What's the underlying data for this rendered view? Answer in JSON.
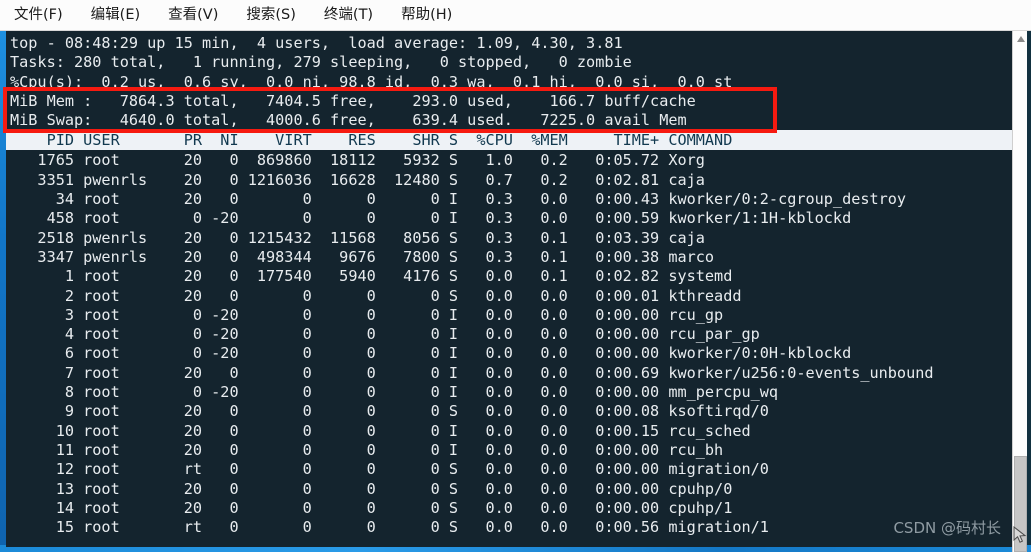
{
  "menubar": {
    "items": [
      {
        "label": "文件(F)"
      },
      {
        "label": "编辑(E)"
      },
      {
        "label": "查看(V)"
      },
      {
        "label": "搜索(S)"
      },
      {
        "label": "终端(T)"
      },
      {
        "label": "帮助(H)"
      }
    ]
  },
  "terminal": {
    "colors": {
      "background": "#14242e",
      "foreground": "#e8ecef",
      "header_background": "#eef2f6",
      "header_foreground": "#12394f",
      "annotation_red": "#f61a10",
      "window_border_blue": "#1b8ad8"
    },
    "summary": {
      "line1": "top - 08:48:29 up 15 min,  4 users,  load average: 1.09, 4.30, 3.81",
      "line2": "Tasks: 280 total,   1 running, 279 sleeping,   0 stopped,   0 zombie",
      "line3": "%Cpu(s):  0.2 us,  0.6 sy,  0.0 ni, 98.8 id,  0.3 wa,  0.1 hi,  0.0 si,  0.0 st",
      "line4": "MiB Mem :   7864.3 total,   7404.5 free,    293.0 used,    166.7 buff/cache",
      "line5": "MiB Swap:   4640.0 total,   4000.6 free,    639.4 used.   7225.0 avail Mem"
    },
    "summary_values": {
      "time": "08:48:29",
      "uptime": "15 min",
      "users": "4",
      "load_average": [
        "1.09",
        "4.30",
        "3.81"
      ],
      "tasks_total": "280",
      "tasks_running": "1",
      "tasks_sleeping": "279",
      "tasks_stopped": "0",
      "tasks_zombie": "0",
      "cpu_us": "0.2",
      "cpu_sy": "0.6",
      "cpu_ni": "0.0",
      "cpu_id": "98.8",
      "cpu_wa": "0.3",
      "cpu_hi": "0.1",
      "cpu_si": "0.0",
      "cpu_st": "0.0",
      "mem_unit": "MiB",
      "mem_total": "7864.3",
      "mem_free": "7404.5",
      "mem_used": "293.0",
      "mem_buff_cache": "166.7",
      "swap_total": "4640.0",
      "swap_free": "4000.6",
      "swap_used": "639.4",
      "swap_avail": "7225.0"
    },
    "column_header": "    PID USER       PR  NI    VIRT    RES    SHR S  %CPU  %MEM     TIME+ COMMAND",
    "columns": [
      "PID",
      "USER",
      "PR",
      "NI",
      "VIRT",
      "RES",
      "SHR",
      "S",
      "%CPU",
      "%MEM",
      "TIME+",
      "COMMAND"
    ],
    "rows": [
      "   1765 root       20   0  869860  18112   5932 S   1.0   0.2   0:05.72 Xorg",
      "   3351 pwenrls    20   0 1216036  16628  12480 S   0.7   0.2   0:02.81 caja",
      "     34 root       20   0       0      0      0 I   0.3   0.0   0:00.43 kworker/0:2-cgroup_destroy",
      "    458 root        0 -20       0      0      0 I   0.3   0.0   0:00.59 kworker/1:1H-kblockd",
      "   2518 pwenrls    20   0 1215432  11568   8056 S   0.3   0.1   0:03.39 caja",
      "   3347 pwenrls    20   0  498344   9676   7800 S   0.3   0.1   0:00.38 marco",
      "      1 root       20   0  177540   5940   4176 S   0.0   0.1   0:02.82 systemd",
      "      2 root       20   0       0      0      0 S   0.0   0.0   0:00.01 kthreadd",
      "      3 root        0 -20       0      0      0 I   0.0   0.0   0:00.00 rcu_gp",
      "      4 root        0 -20       0      0      0 I   0.0   0.0   0:00.00 rcu_par_gp",
      "      6 root        0 -20       0      0      0 I   0.0   0.0   0:00.00 kworker/0:0H-kblockd",
      "      7 root       20   0       0      0      0 I   0.0   0.0   0:00.69 kworker/u256:0-events_unbound",
      "      8 root        0 -20       0      0      0 I   0.0   0.0   0:00.00 mm_percpu_wq",
      "      9 root       20   0       0      0      0 S   0.0   0.0   0:00.08 ksoftirqd/0",
      "     10 root       20   0       0      0      0 I   0.0   0.0   0:00.15 rcu_sched",
      "     11 root       20   0       0      0      0 I   0.0   0.0   0:00.00 rcu_bh",
      "     12 root       rt   0       0      0      0 S   0.0   0.0   0:00.00 migration/0",
      "     13 root       20   0       0      0      0 S   0.0   0.0   0:00.00 cpuhp/0",
      "     14 root       20   0       0      0      0 S   0.0   0.0   0:00.00 cpuhp/1",
      "     15 root       rt   0       0      0      0 S   0.0   0.0   0:00.56 migration/1"
    ],
    "rows_data": [
      {
        "pid": "1765",
        "user": "root",
        "pr": "20",
        "ni": "0",
        "virt": "869860",
        "res": "18112",
        "shr": "5932",
        "s": "S",
        "cpu": "1.0",
        "mem": "0.2",
        "time": "0:05.72",
        "command": "Xorg"
      },
      {
        "pid": "3351",
        "user": "pwenrls",
        "pr": "20",
        "ni": "0",
        "virt": "1216036",
        "res": "16628",
        "shr": "12480",
        "s": "S",
        "cpu": "0.7",
        "mem": "0.2",
        "time": "0:02.81",
        "command": "caja"
      },
      {
        "pid": "34",
        "user": "root",
        "pr": "20",
        "ni": "0",
        "virt": "0",
        "res": "0",
        "shr": "0",
        "s": "I",
        "cpu": "0.3",
        "mem": "0.0",
        "time": "0:00.43",
        "command": "kworker/0:2-cgroup_destroy"
      },
      {
        "pid": "458",
        "user": "root",
        "pr": "0",
        "ni": "-20",
        "virt": "0",
        "res": "0",
        "shr": "0",
        "s": "I",
        "cpu": "0.3",
        "mem": "0.0",
        "time": "0:00.59",
        "command": "kworker/1:1H-kblockd"
      },
      {
        "pid": "2518",
        "user": "pwenrls",
        "pr": "20",
        "ni": "0",
        "virt": "1215432",
        "res": "11568",
        "shr": "8056",
        "s": "S",
        "cpu": "0.3",
        "mem": "0.1",
        "time": "0:03.39",
        "command": "caja"
      },
      {
        "pid": "3347",
        "user": "pwenrls",
        "pr": "20",
        "ni": "0",
        "virt": "498344",
        "res": "9676",
        "shr": "7800",
        "s": "S",
        "cpu": "0.3",
        "mem": "0.1",
        "time": "0:00.38",
        "command": "marco"
      },
      {
        "pid": "1",
        "user": "root",
        "pr": "20",
        "ni": "0",
        "virt": "177540",
        "res": "5940",
        "shr": "4176",
        "s": "S",
        "cpu": "0.0",
        "mem": "0.1",
        "time": "0:02.82",
        "command": "systemd"
      },
      {
        "pid": "2",
        "user": "root",
        "pr": "20",
        "ni": "0",
        "virt": "0",
        "res": "0",
        "shr": "0",
        "s": "S",
        "cpu": "0.0",
        "mem": "0.0",
        "time": "0:00.01",
        "command": "kthreadd"
      },
      {
        "pid": "3",
        "user": "root",
        "pr": "0",
        "ni": "-20",
        "virt": "0",
        "res": "0",
        "shr": "0",
        "s": "I",
        "cpu": "0.0",
        "mem": "0.0",
        "time": "0:00.00",
        "command": "rcu_gp"
      },
      {
        "pid": "4",
        "user": "root",
        "pr": "0",
        "ni": "-20",
        "virt": "0",
        "res": "0",
        "shr": "0",
        "s": "I",
        "cpu": "0.0",
        "mem": "0.0",
        "time": "0:00.00",
        "command": "rcu_par_gp"
      },
      {
        "pid": "6",
        "user": "root",
        "pr": "0",
        "ni": "-20",
        "virt": "0",
        "res": "0",
        "shr": "0",
        "s": "I",
        "cpu": "0.0",
        "mem": "0.0",
        "time": "0:00.00",
        "command": "kworker/0:0H-kblockd"
      },
      {
        "pid": "7",
        "user": "root",
        "pr": "20",
        "ni": "0",
        "virt": "0",
        "res": "0",
        "shr": "0",
        "s": "I",
        "cpu": "0.0",
        "mem": "0.0",
        "time": "0:00.69",
        "command": "kworker/u256:0-events_unbound"
      },
      {
        "pid": "8",
        "user": "root",
        "pr": "0",
        "ni": "-20",
        "virt": "0",
        "res": "0",
        "shr": "0",
        "s": "I",
        "cpu": "0.0",
        "mem": "0.0",
        "time": "0:00.00",
        "command": "mm_percpu_wq"
      },
      {
        "pid": "9",
        "user": "root",
        "pr": "20",
        "ni": "0",
        "virt": "0",
        "res": "0",
        "shr": "0",
        "s": "S",
        "cpu": "0.0",
        "mem": "0.0",
        "time": "0:00.08",
        "command": "ksoftirqd/0"
      },
      {
        "pid": "10",
        "user": "root",
        "pr": "20",
        "ni": "0",
        "virt": "0",
        "res": "0",
        "shr": "0",
        "s": "I",
        "cpu": "0.0",
        "mem": "0.0",
        "time": "0:00.15",
        "command": "rcu_sched"
      },
      {
        "pid": "11",
        "user": "root",
        "pr": "20",
        "ni": "0",
        "virt": "0",
        "res": "0",
        "shr": "0",
        "s": "I",
        "cpu": "0.0",
        "mem": "0.0",
        "time": "0:00.00",
        "command": "rcu_bh"
      },
      {
        "pid": "12",
        "user": "root",
        "pr": "rt",
        "ni": "0",
        "virt": "0",
        "res": "0",
        "shr": "0",
        "s": "S",
        "cpu": "0.0",
        "mem": "0.0",
        "time": "0:00.00",
        "command": "migration/0"
      },
      {
        "pid": "13",
        "user": "root",
        "pr": "20",
        "ni": "0",
        "virt": "0",
        "res": "0",
        "shr": "0",
        "s": "S",
        "cpu": "0.0",
        "mem": "0.0",
        "time": "0:00.00",
        "command": "cpuhp/0"
      },
      {
        "pid": "14",
        "user": "root",
        "pr": "20",
        "ni": "0",
        "virt": "0",
        "res": "0",
        "shr": "0",
        "s": "S",
        "cpu": "0.0",
        "mem": "0.0",
        "time": "0:00.00",
        "command": "cpuhp/1"
      },
      {
        "pid": "15",
        "user": "root",
        "pr": "rt",
        "ni": "0",
        "virt": "0",
        "res": "0",
        "shr": "0",
        "s": "S",
        "cpu": "0.0",
        "mem": "0.0",
        "time": "0:00.56",
        "command": "migration/1"
      }
    ]
  },
  "watermark": {
    "text": "CSDN @码村长"
  }
}
